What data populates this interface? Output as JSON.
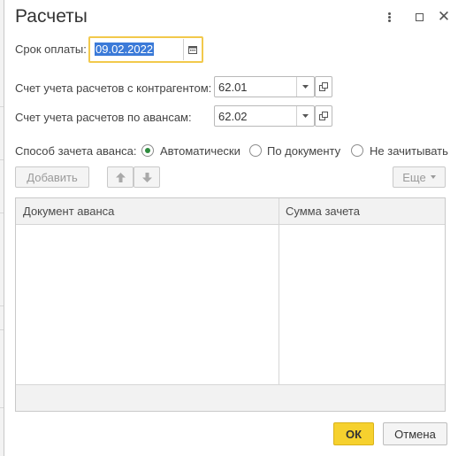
{
  "dialog": {
    "title": "Расчеты"
  },
  "payment_term": {
    "label": "Срок оплаты:",
    "value": "09.02.2022"
  },
  "contractor_account": {
    "label": "Счет учета расчетов с контрагентом:",
    "value": "62.01"
  },
  "advance_account": {
    "label": "Счет учета расчетов по авансам:",
    "value": "62.02"
  },
  "advance_method": {
    "label": "Способ зачета аванса:",
    "options": [
      "Автоматически",
      "По документу",
      "Не зачитывать"
    ],
    "selected": "Автоматически"
  },
  "toolbar": {
    "add_label": "Добавить",
    "more_label": "Еще"
  },
  "table": {
    "columns": [
      "Документ аванса",
      "Сумма зачета"
    ],
    "rows": []
  },
  "footer": {
    "ok_label": "ОК",
    "cancel_label": "Отмена"
  },
  "colors": {
    "accent_yellow": "#f6d12e",
    "selection_blue": "#3b7ad8",
    "radio_green": "#2e8b3e"
  }
}
